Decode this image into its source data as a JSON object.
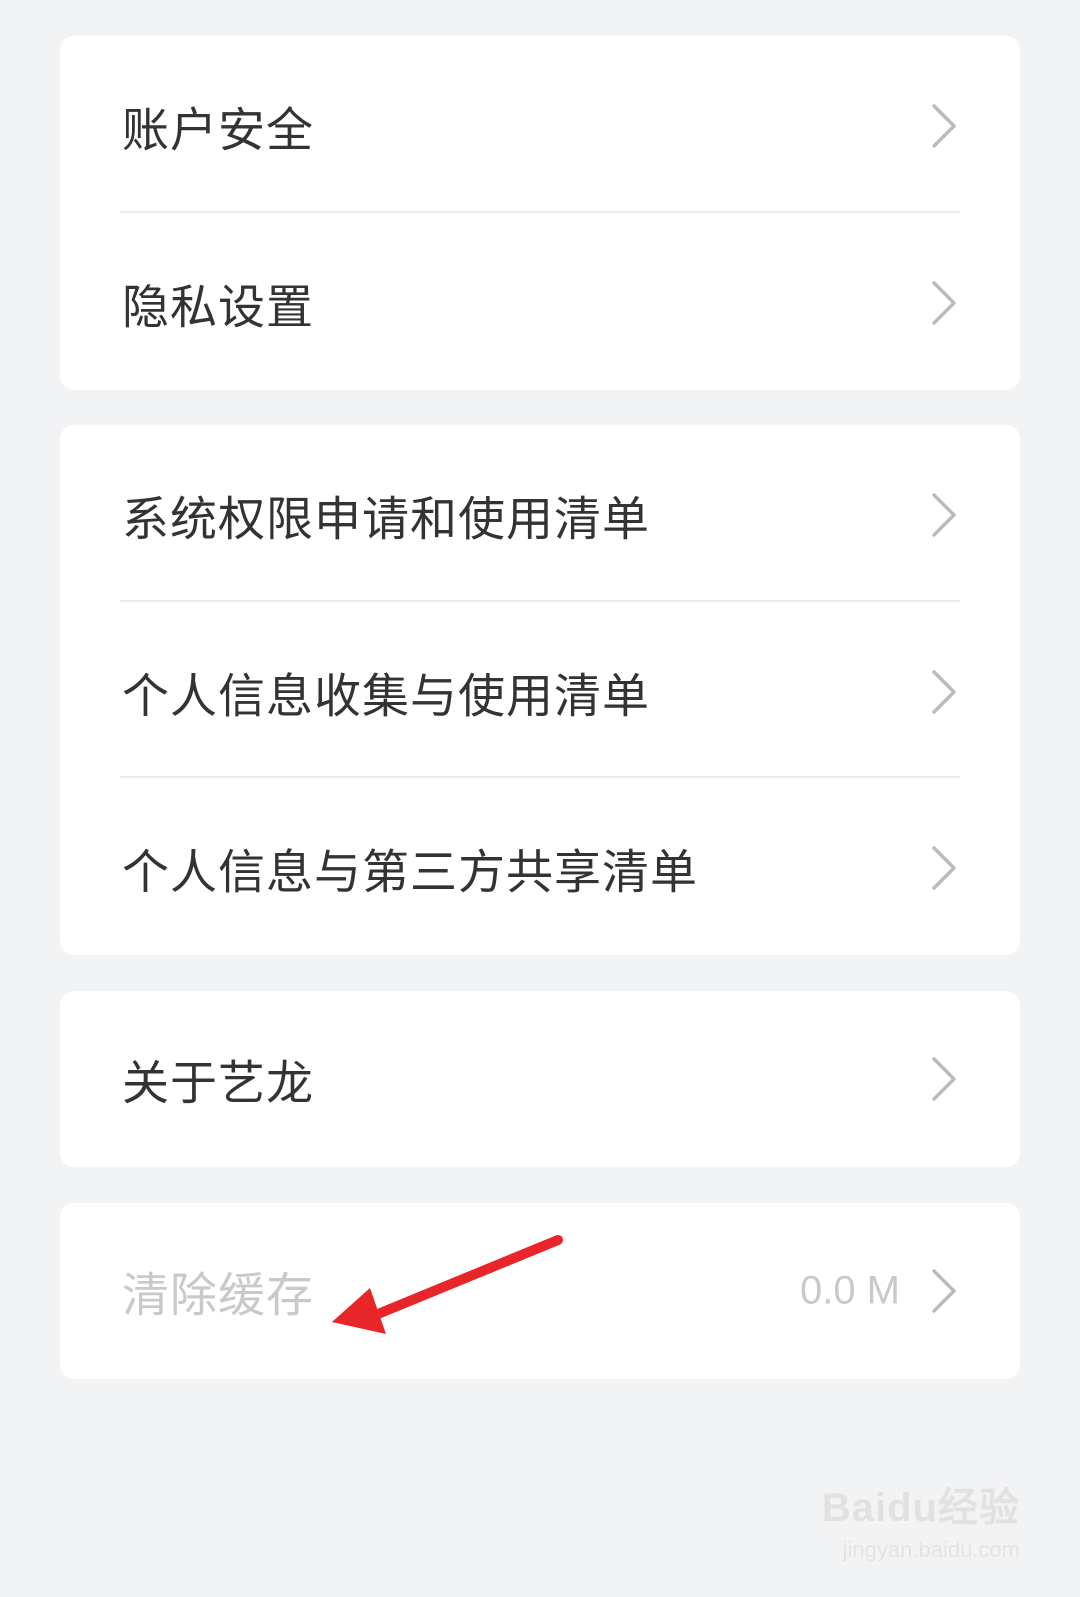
{
  "group1": {
    "items": [
      {
        "label": "账户安全"
      },
      {
        "label": "隐私设置"
      }
    ]
  },
  "group2": {
    "items": [
      {
        "label": "系统权限申请和使用清单"
      },
      {
        "label": "个人信息收集与使用清单"
      },
      {
        "label": "个人信息与第三方共享清单"
      }
    ]
  },
  "group3": {
    "items": [
      {
        "label": "关于艺龙"
      }
    ]
  },
  "group4": {
    "items": [
      {
        "label": "清除缓存",
        "value": "0.0 M"
      }
    ]
  },
  "watermark": {
    "logo": "Baidu经验",
    "url": "jingyan.baidu.com"
  },
  "colors": {
    "background": "#f2f3f5",
    "card": "#ffffff",
    "text": "#333333",
    "disabled_text": "#c9c9c9",
    "chevron": "#bbbbbb",
    "annotation_arrow": "#e8262a"
  },
  "icons": [
    "chevron-right-icon",
    "red-arrow-annotation"
  ]
}
